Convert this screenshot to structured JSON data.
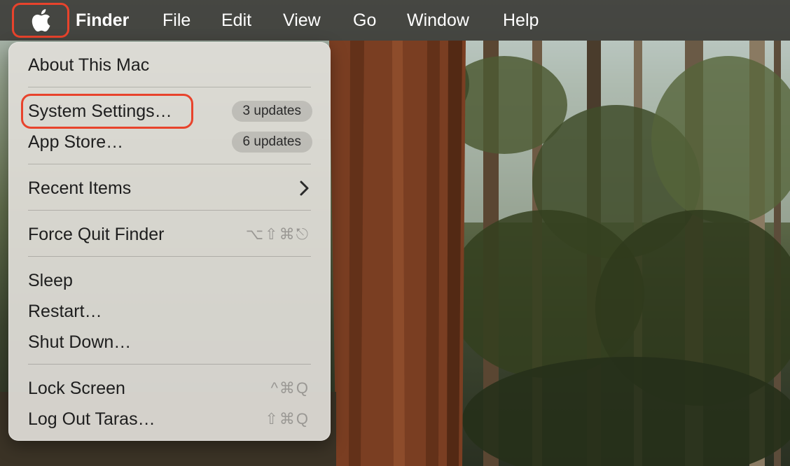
{
  "menubar": {
    "apple_icon": "apple-logo-icon",
    "items": [
      "Finder",
      "File",
      "Edit",
      "View",
      "Go",
      "Window",
      "Help"
    ]
  },
  "apple_menu": {
    "about": "About This Mac",
    "system_settings": "System Settings…",
    "system_settings_badge": "3 updates",
    "app_store": "App Store…",
    "app_store_badge": "6 updates",
    "recent_items": "Recent Items",
    "recent_items_icon": "chevron-right-icon",
    "force_quit": "Force Quit Finder",
    "force_quit_shortcut": "⌥⇧⌘⎋",
    "sleep": "Sleep",
    "restart": "Restart…",
    "shut_down": "Shut Down…",
    "lock_screen": "Lock Screen",
    "lock_screen_shortcut": "^⌘Q",
    "log_out": "Log Out Taras…",
    "log_out_shortcut": "⇧⌘Q"
  },
  "colors": {
    "highlight": "#e8432c",
    "menubar_bg": "#3c3c37",
    "menu_bg": "#e0ded8"
  }
}
